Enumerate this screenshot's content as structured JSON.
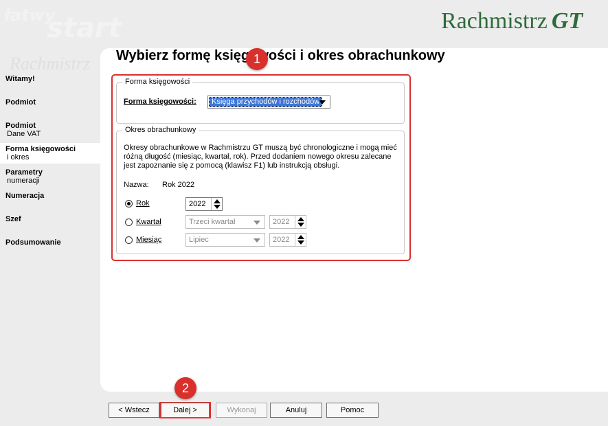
{
  "header": {
    "watermark_1": "łatwy",
    "watermark_2": "start",
    "watermark_3": "Rachmistrz",
    "logo_text": "Rachmistrz",
    "logo_gt": "GT"
  },
  "sidebar": {
    "items": [
      {
        "title": "Witamy!",
        "sub": ""
      },
      {
        "title": "Podmiot",
        "sub": ""
      },
      {
        "title": "Podmiot",
        "sub": "Dane VAT"
      },
      {
        "title": "Forma księgowości",
        "sub": "i okres"
      },
      {
        "title": "Parametry",
        "sub": "numeracji"
      },
      {
        "title": "Numeracja",
        "sub": ""
      },
      {
        "title": "Szef",
        "sub": ""
      },
      {
        "title": "Podsumowanie",
        "sub": ""
      }
    ]
  },
  "main": {
    "title": "Wybierz formę księgowości i okres obrachunkowy",
    "forma_group": {
      "legend": "Forma księgowości",
      "label": "Forma księgowości:",
      "value": "Księga przychodów i rozchodów"
    },
    "okres_group": {
      "legend": "Okres obrachunkowy",
      "description": "Okresy obrachunkowe w Rachmistrzu GT muszą być chronologiczne i mogą mieć różną długość (miesiąc, kwartał, rok). Przed dodaniem nowego okresu zalecane jest zapoznanie się z pomocą (klawisz F1) lub instrukcją obsługi.",
      "nazwa_label": "Nazwa:",
      "nazwa_value": "Rok 2022",
      "rok": {
        "label": "Rok",
        "year": "2022",
        "checked": true
      },
      "kwartal": {
        "label": "Kwartał",
        "select": "Trzeci kwartał",
        "year": "2022"
      },
      "miesiac": {
        "label": "Miesiąc",
        "select": "Lipiec",
        "year": "2022"
      }
    }
  },
  "badges": {
    "one": "1",
    "two": "2"
  },
  "buttons": {
    "back": "< Wstecz",
    "next": "Dalej >",
    "execute": "Wykonaj",
    "cancel": "Anuluj",
    "help": "Pomoc"
  },
  "colors": {
    "accent_red": "#d9302c",
    "logo_green": "#2f6b3c",
    "selection_blue": "#3d76d8"
  }
}
